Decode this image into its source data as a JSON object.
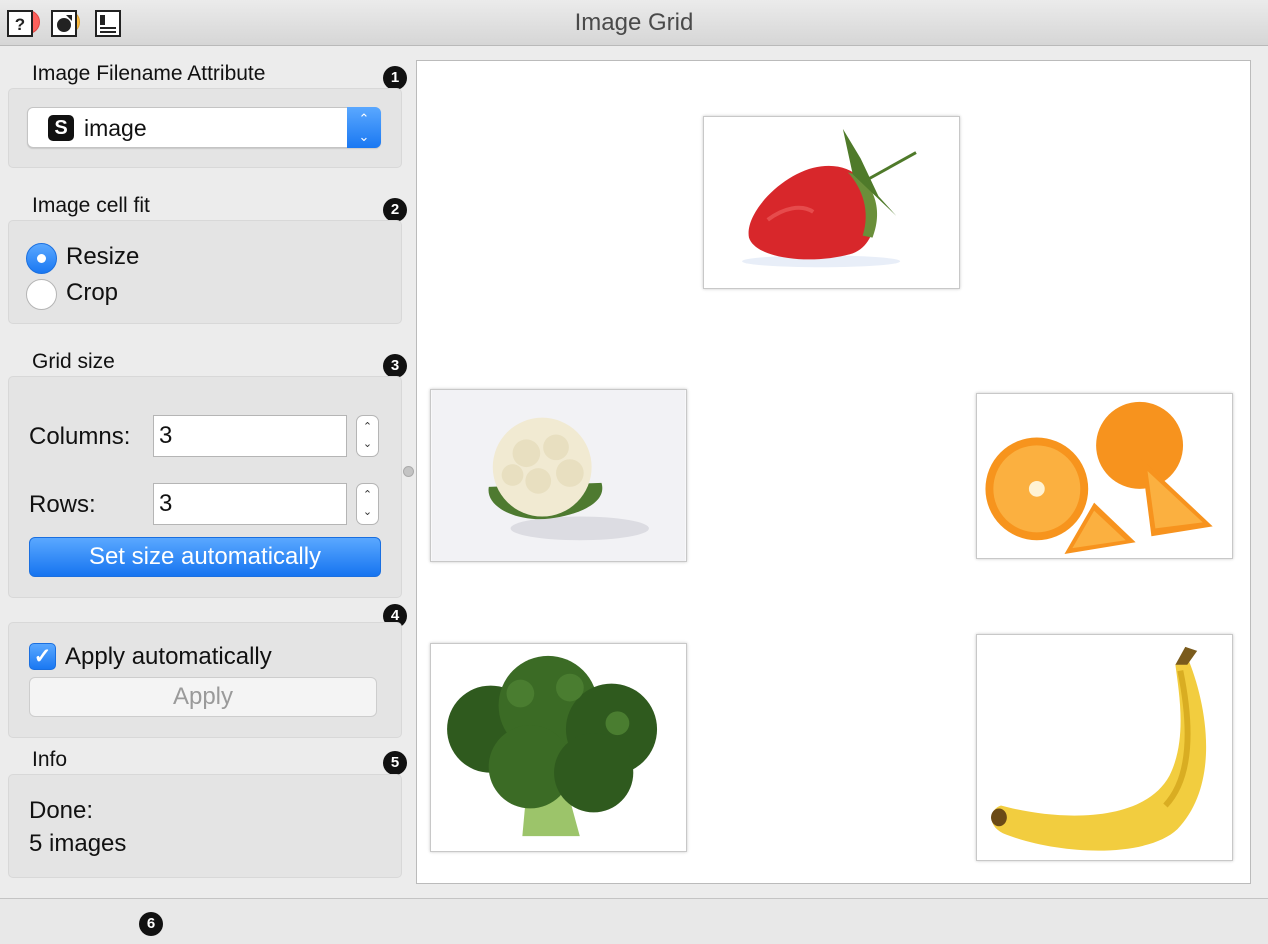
{
  "window": {
    "title": "Image Grid"
  },
  "callouts": {
    "one": "1",
    "two": "2",
    "three": "3",
    "four": "4",
    "five": "5",
    "six": "6"
  },
  "filename_section": {
    "label": "Image Filename Attribute",
    "selected": "image",
    "type_icon": "S"
  },
  "fit_section": {
    "label": "Image cell fit",
    "options": [
      {
        "label": "Resize",
        "selected": true
      },
      {
        "label": "Crop",
        "selected": false
      }
    ]
  },
  "grid_section": {
    "label": "Grid size",
    "columns_label": "Columns:",
    "columns_value": "3",
    "rows_label": "Rows:",
    "rows_value": "3",
    "auto_button": "Set size automatically"
  },
  "apply_section": {
    "checkbox_label": "Apply automatically",
    "checked": true,
    "apply_button": "Apply"
  },
  "info_section": {
    "label": "Info",
    "line1": "Done:",
    "line2": "5 images"
  },
  "grid_images": [
    {
      "name": "strawberry",
      "row": 1,
      "col": 2
    },
    {
      "name": "cauliflower",
      "row": 2,
      "col": 1
    },
    {
      "name": "orange",
      "row": 2,
      "col": 3
    },
    {
      "name": "broccoli",
      "row": 3,
      "col": 1
    },
    {
      "name": "banana",
      "row": 3,
      "col": 3
    }
  ],
  "status_icons": [
    "help-icon",
    "report-icon",
    "output-preview-icon"
  ],
  "colors": {
    "accent": "#1a78f2",
    "close": "#fc605b",
    "minimize": "#fdbc40",
    "maximize": "#34c84a"
  }
}
